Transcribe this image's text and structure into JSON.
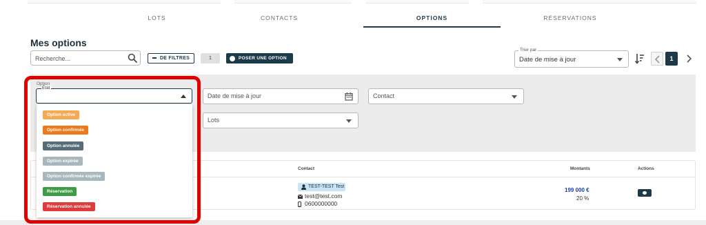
{
  "tabs": [
    {
      "label": "LOTS",
      "active": false
    },
    {
      "label": "CONTACTS",
      "active": false
    },
    {
      "label": "OPTIONS",
      "active": true
    },
    {
      "label": "RÉSERVATIONS",
      "active": false
    }
  ],
  "page_title": "Mes options",
  "toolbar": {
    "search_placeholder": "Recherche...",
    "filters_label": "DE FILTRES",
    "filters_count": "1",
    "add_label": "POSER UNE OPTION",
    "sort_legend": "Trier par",
    "sort_value": "Date de mise à jour",
    "page_number": "1"
  },
  "filters": {
    "group_label": "Option",
    "state_label": "État",
    "date_placeholder": "Date de mise à jour",
    "contact_placeholder": "Contact",
    "lots_placeholder": "Lots"
  },
  "state_options": [
    {
      "label": "Option active",
      "color": "#f5a953"
    },
    {
      "label": "Option confirmée",
      "color": "#ec7a1c"
    },
    {
      "label": "Option annulée",
      "color": "#566c76"
    },
    {
      "label": "Option expirée",
      "color": "#a8b6bd"
    },
    {
      "label": "Option confirmée expirée",
      "color": "#a8b6bd"
    },
    {
      "label": "Réservation",
      "color": "#3e9c45"
    },
    {
      "label": "Réservation annulée",
      "color": "#e03a3a"
    }
  ],
  "table": {
    "headers": {
      "contact": "Contact",
      "amounts": "Montants",
      "actions": "Actions"
    },
    "rows": [
      {
        "contact_name": "TEST-TEST Test",
        "email": "test@test.com",
        "phone": "0600000000",
        "amount": "199 000 €",
        "percent": "20 %"
      }
    ]
  },
  "colors": {
    "primary": "#1c3a4a",
    "highlight": "#e00000",
    "link": "#1a3fa0"
  }
}
